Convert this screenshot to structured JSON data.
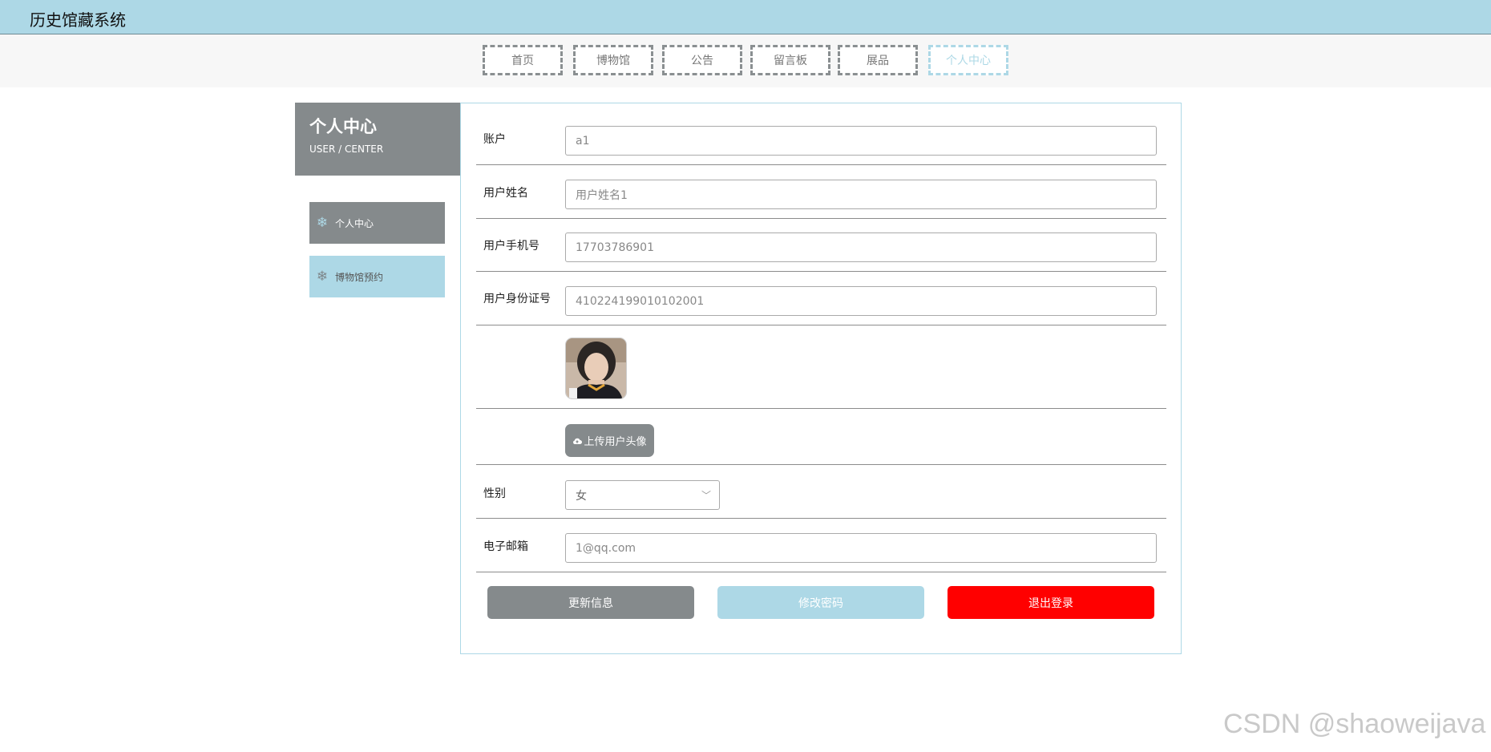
{
  "app": {
    "title": "历史馆藏系统"
  },
  "nav": {
    "items": [
      {
        "label": "首页"
      },
      {
        "label": "博物馆"
      },
      {
        "label": "公告"
      },
      {
        "label": "留言板"
      },
      {
        "label": "展品"
      },
      {
        "label": "个人中心",
        "active": true
      }
    ]
  },
  "sidebar": {
    "heading": "个人中心",
    "subheading": "USER / CENTER",
    "items": [
      {
        "label": "个人中心",
        "icon": "snowflake-icon",
        "active": true
      },
      {
        "label": "博物馆预约",
        "icon": "snowflake-icon",
        "active": false
      }
    ]
  },
  "form": {
    "account": {
      "label": "账户",
      "value": "a1"
    },
    "username": {
      "label": "用户姓名",
      "value": "用户姓名1"
    },
    "phone": {
      "label": "用户手机号",
      "value": "17703786901"
    },
    "idcard": {
      "label": "用户身份证号",
      "value": "410224199010102001"
    },
    "avatar": {
      "upload_label": "上传用户头像"
    },
    "gender": {
      "label": "性别",
      "value": "女"
    },
    "email": {
      "label": "电子邮箱",
      "value": "1@qq.com"
    }
  },
  "actions": {
    "update": "更新信息",
    "change_password": "修改密码",
    "logout": "退出登录"
  },
  "watermark": "CSDN @shaoweijava",
  "colors": {
    "accent": "#add8e6",
    "gray": "#858a8c",
    "danger": "#ff0000"
  }
}
